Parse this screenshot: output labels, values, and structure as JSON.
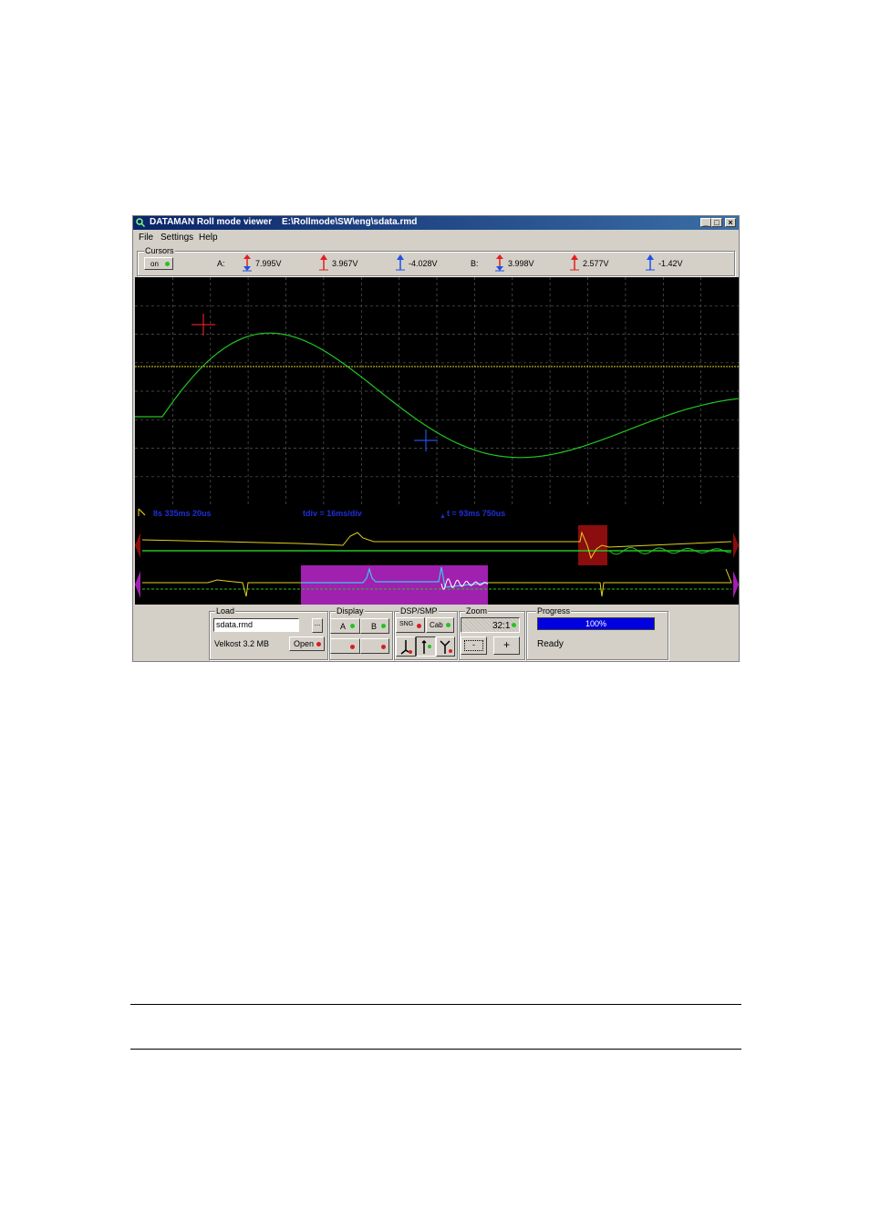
{
  "window": {
    "title": "DATAMAN Roll mode viewer",
    "file_path": "E:\\Rollmode\\SW\\eng\\sdata.rmd",
    "controls": {
      "minimize": "_",
      "maximize": "□",
      "close": "×"
    }
  },
  "menu": {
    "items": [
      "File",
      "Settings",
      "Help"
    ]
  },
  "cursors": {
    "group_label": "Cursors",
    "toggle_label": "on",
    "a": {
      "label": "A:",
      "delta": "7.995V",
      "red": "3.967V",
      "blue": "-4.028V"
    },
    "b": {
      "label": "B:",
      "delta": "3.998V",
      "red": "2.577V",
      "blue": "-1.42V"
    }
  },
  "status": {
    "position": "8s 335ms 20us",
    "tdiv": "tdiv =  16ms/div",
    "dt": "t =  93ms 750us"
  },
  "load": {
    "group_label": "Load",
    "filename": "sdata.rmd",
    "browse_label": "...",
    "size": "Velkost 3.2 MB",
    "open_label": "Open"
  },
  "display": {
    "group_label": "Display",
    "a_label": "A",
    "b_label": "B"
  },
  "dsp": {
    "group_label": "DSP/SMP",
    "sng_label": "SNG",
    "cab_label": "Cab"
  },
  "zoom": {
    "group_label": "Zoom",
    "ratio": "32:1",
    "minus_label": "-",
    "plus_label": "+"
  },
  "progress": {
    "group_label": "Progress",
    "value": 100,
    "text": "100%",
    "state": "Ready"
  },
  "colors": {
    "trace_green": "#22c422",
    "trace_yellow": "#e0d020",
    "trace_cyan": "#3cc8e8",
    "cursor_red": "#e02020",
    "cursor_blue": "#2050e0",
    "grid": "#5a5a5a",
    "status_blue": "#1f2fd6",
    "highlight_red": "#8b0d0d",
    "highlight_magenta": "#a020b0",
    "progress_blue": "#0000e0"
  }
}
